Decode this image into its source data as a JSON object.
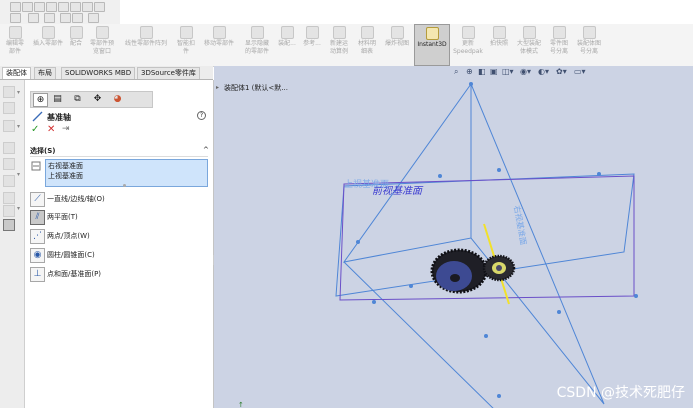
{
  "ribbon": {
    "buttons": [
      {
        "label": "编辑零\n部件",
        "icon": "edit-part-icon"
      },
      {
        "label": "插入零部件",
        "icon": "insert-component-icon"
      },
      {
        "label": "配合",
        "icon": "mate-icon"
      },
      {
        "label": "零部件预\n览窗口",
        "icon": "component-preview-icon"
      },
      {
        "label": "线性零部件阵列",
        "icon": "linear-pattern-icon"
      },
      {
        "label": "智能扣\n件",
        "icon": "smart-fasteners-icon"
      },
      {
        "label": "移动零部件",
        "icon": "move-component-icon"
      },
      {
        "label": "显示隐藏\n的零部件",
        "icon": "show-hidden-icon"
      },
      {
        "label": "装配...",
        "icon": "assembly-features-icon"
      },
      {
        "label": "参考...",
        "icon": "reference-geometry-icon"
      },
      {
        "label": "新建运\n动算例",
        "icon": "new-motion-study-icon"
      },
      {
        "label": "材料明\n细表",
        "icon": "bom-icon"
      },
      {
        "label": "爆炸视图",
        "icon": "exploded-view-icon"
      },
      {
        "label": "Instant3D",
        "icon": "instant3d-icon"
      },
      {
        "label": "更新\nSpeedpak",
        "icon": "speedpak-icon"
      },
      {
        "label": "拍快照",
        "icon": "snapshot-icon"
      },
      {
        "label": "大型装配\n体模式",
        "icon": "large-assembly-icon"
      },
      {
        "label": "零件图\n号分离",
        "icon": "part-number-icon"
      },
      {
        "label": "装配体图\n号分离",
        "icon": "assembly-number-icon"
      }
    ]
  },
  "tabs": [
    "装配体",
    "布局",
    "SOLIDWORKS MBD",
    "3DSource零件库"
  ],
  "tree": {
    "label": "装配体1 (默认<默..."
  },
  "pm": {
    "title": "基准轴",
    "help": "?",
    "ok": "✓",
    "cancel": "✕",
    "pin": "⇥",
    "selection_header": "选择(S)",
    "selection_items": [
      "右视基准面",
      "上视基准面"
    ],
    "options": [
      {
        "label": "一直线/边线/轴(O)",
        "glyph": "⟋"
      },
      {
        "label": "两平面(T)",
        "glyph": "⫽"
      },
      {
        "label": "两点/顶点(W)",
        "glyph": "⋰"
      },
      {
        "label": "圆柱/圆锥面(C)",
        "glyph": "◉"
      },
      {
        "label": "点和面/基准面(P)",
        "glyph": "⊥"
      }
    ]
  },
  "viewport": {
    "plane_front": "前视基准面",
    "plane_top": "上视基准面",
    "plane_right": "右视基准面",
    "watermark": "CSDN @技术死肥仔"
  },
  "colors": {
    "plane_blue": "#4f86d6",
    "plane_purple": "#6a4fc8",
    "axis_yellow": "#f2e12a",
    "gear_dark": "#1f1f26",
    "gear_blue": "#404a8c",
    "instant3d_active": "#cfcfcf"
  }
}
